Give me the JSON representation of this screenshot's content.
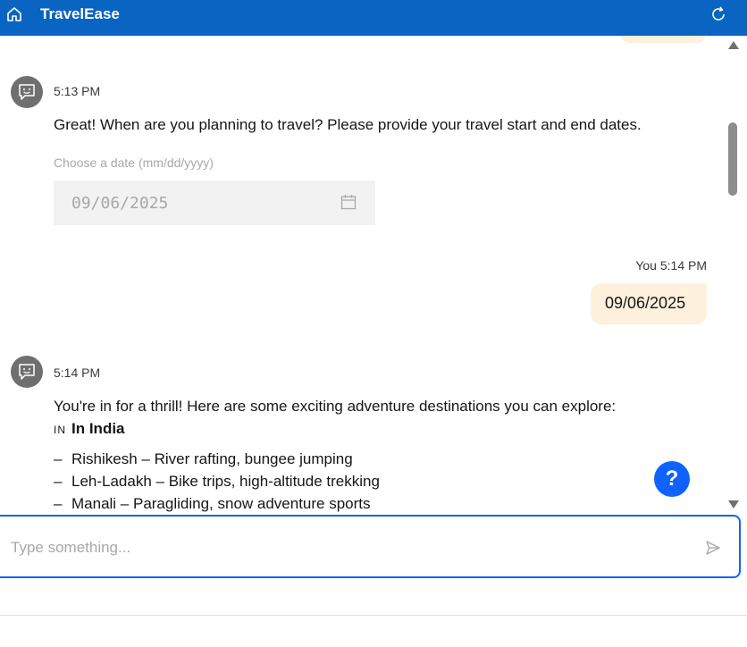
{
  "header": {
    "title": "TravelEase",
    "home_icon": "home-icon",
    "refresh_icon": "refresh-icon",
    "background": "#0a64c2"
  },
  "messages": {
    "bot_1": {
      "time": "5:13 PM",
      "text": "Great! When are you planning to travel? Please provide your travel start and end dates.",
      "date_picker": {
        "label": "Choose a date (mm/dd/yyyy)",
        "value": "09/06/2025"
      }
    },
    "user_1": {
      "meta": "You 5:14 PM",
      "text": "09/06/2025"
    },
    "bot_2": {
      "time": "5:14 PM",
      "intro": "You're in for a thrill! Here are some exciting adventure destinations you can explore:",
      "country_code": "IN",
      "country": "In India",
      "destinations": [
        "Rishikesh – River rafting, bungee jumping",
        "Leh-Ladakh – Bike trips, high-altitude trekking",
        "Manali – Paragliding, snow adventure sports"
      ],
      "dash": "–"
    }
  },
  "help_button": {
    "label": "?"
  },
  "composer": {
    "placeholder": "Type something...",
    "value": ""
  },
  "colors": {
    "accent": "#0f62fe",
    "user_bubble": "#fdf1dd",
    "avatar": "#6f6f6f"
  }
}
